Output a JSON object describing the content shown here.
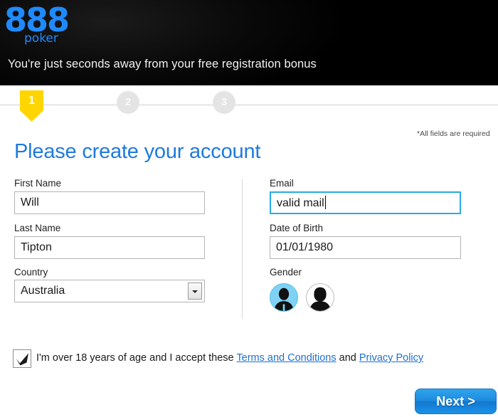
{
  "header": {
    "logo_888": "888",
    "logo_word": "poker",
    "tagline": "You're just seconds away from your free registration bonus"
  },
  "steps": {
    "items": [
      {
        "number": "1",
        "state": "active"
      },
      {
        "number": "2",
        "state": "inactive"
      },
      {
        "number": "3",
        "state": "inactive"
      }
    ]
  },
  "form": {
    "required_note": "*All fields are required",
    "title": "Please create your account",
    "first_name": {
      "label": "First Name",
      "value": "Will"
    },
    "last_name": {
      "label": "Last Name",
      "value": "Tipton"
    },
    "country": {
      "label": "Country",
      "value": "Australia"
    },
    "email": {
      "label": "Email",
      "value": "valid mail",
      "focused": true
    },
    "date_of_birth": {
      "label": "Date of Birth",
      "value": "01/01/1980"
    },
    "gender": {
      "label": "Gender",
      "options": [
        {
          "name": "male",
          "selected": true
        },
        {
          "name": "female",
          "selected": false
        }
      ]
    }
  },
  "consent": {
    "checked": true,
    "text_before": "I'm over 18 years of age and I accept these ",
    "terms_link": "Terms and Conditions",
    "text_middle": " and ",
    "privacy_link": "Privacy Policy"
  },
  "footer": {
    "next_label": "Next >"
  },
  "colors": {
    "brand_blue": "#1f8aff",
    "title_blue": "#1f7ae0",
    "accent_yellow": "#ffd500",
    "focus_blue": "#29ABE2",
    "button_blue": "#1e8ade",
    "header_black": "#000000"
  }
}
